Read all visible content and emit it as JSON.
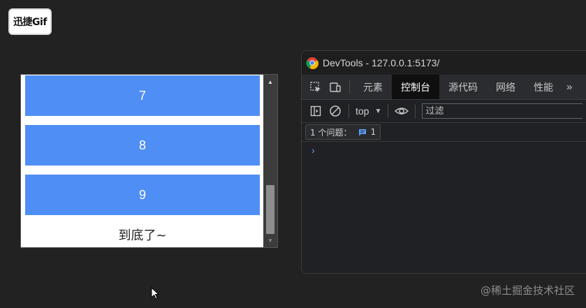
{
  "watermark": {
    "badge_text": "迅捷Gif",
    "footer_text": "@稀土掘金技术社区"
  },
  "preview": {
    "items": [
      "7",
      "8",
      "9"
    ],
    "end_text": "到底了~"
  },
  "devtools": {
    "title": "DevTools - 127.0.0.1:5173/",
    "tabs": [
      {
        "label": "元素"
      },
      {
        "label": "控制台",
        "active": true
      },
      {
        "label": "源代码"
      },
      {
        "label": "网络"
      },
      {
        "label": "性能"
      }
    ],
    "more_tabs": "»",
    "context": "top",
    "filter_placeholder": "过滤",
    "issues_label": "1 个问题：",
    "issues_count": "1",
    "prompt": "›"
  },
  "colors": {
    "list_item": "#4f8ef5",
    "active_tab": "#0f0f10",
    "prompt": "#6ea1ff"
  },
  "icons": [
    "inspect-icon",
    "device-toggle-icon",
    "sidebar-toggle-icon",
    "clear-console-icon",
    "eye-icon",
    "issue-message-icon",
    "chrome-icon",
    "cursor-icon"
  ]
}
